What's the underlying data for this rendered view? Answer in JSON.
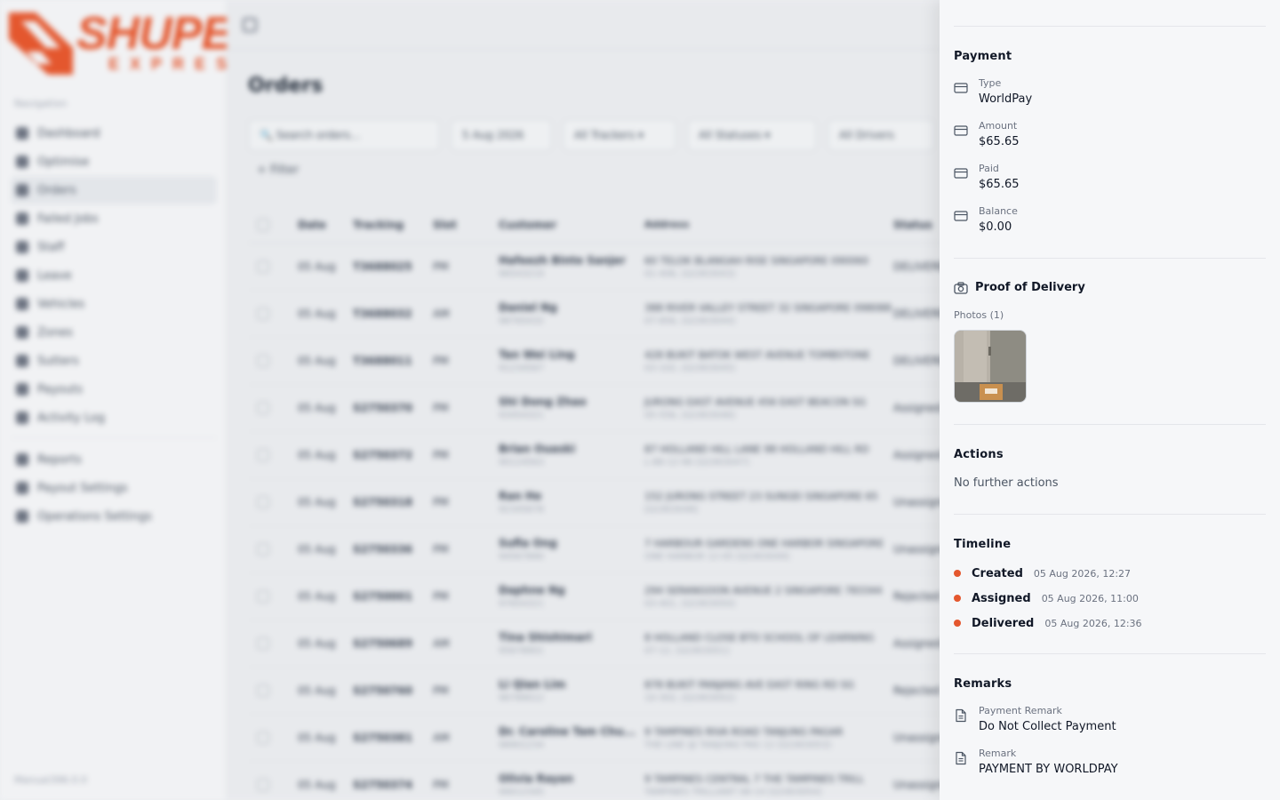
{
  "brand": {
    "name": "SHUPER",
    "sub": "EXPRESS",
    "color": "#e4572e"
  },
  "sidebar": {
    "heading": "Navigation",
    "items": [
      {
        "label": "Dashboard",
        "icon": "grid-icon"
      },
      {
        "label": "Optimise",
        "icon": "route-icon"
      },
      {
        "label": "Orders",
        "icon": "box-icon",
        "active": true
      },
      {
        "label": "Failed Jobs",
        "icon": "alert-icon"
      },
      {
        "label": "Staff",
        "icon": "users-icon"
      },
      {
        "label": "Leave",
        "icon": "calendar-icon"
      },
      {
        "label": "Vehicles",
        "icon": "truck-icon"
      },
      {
        "label": "Zones",
        "icon": "map-icon"
      },
      {
        "label": "Sutters",
        "icon": "people-icon"
      },
      {
        "label": "Payouts",
        "icon": "wallet-icon"
      },
      {
        "label": "Activity Log",
        "icon": "activity-icon"
      }
    ],
    "items2": [
      {
        "label": "Reports",
        "icon": "chart-icon"
      },
      {
        "label": "Payout Settings",
        "icon": "dollar-icon"
      },
      {
        "label": "Operations Settings",
        "icon": "gear-icon"
      }
    ],
    "version": "Manual396.0.0"
  },
  "main": {
    "title": "Orders",
    "filters": {
      "search_placeholder": "Search orders...",
      "date": "5 Aug 2026",
      "tracking": "All Trackers",
      "statuses": "All Statuses",
      "drivers": "All Drivers",
      "filter_label": "+ Filter"
    },
    "columns": [
      "Date",
      "Tracking",
      "Slot",
      "Customer",
      "Address",
      "Status"
    ],
    "rows": [
      {
        "date": "05 Aug",
        "tracking": "T3688025",
        "slot": "PM",
        "name": "Hafeezh Binte Sanjer",
        "phone": "96543219",
        "addr": "60 TELOK BLANGAH RISE SINGAPORE 090060",
        "addr2": "01-406, [Q1903043]",
        "status": "DELIVERED"
      },
      {
        "date": "05 Aug",
        "tracking": "T3688032",
        "slot": "AM",
        "name": "Daniel Ng",
        "phone": "98765432",
        "addr": "388 RIVER VALLEY STREET 32 SINGAPORE 098088",
        "addr2": "07-856, [Q1903044]",
        "status": "DELIVERED"
      },
      {
        "date": "05 Aug",
        "tracking": "T3688011",
        "slot": "PM",
        "name": "Tan Wei Ling",
        "phone": "91234567",
        "addr": "428 BUKIT BATOK WEST AVENUE TOMBSTONE",
        "addr2": "03-102, [Q1903045]",
        "status": "DELIVERED"
      },
      {
        "date": "05 Aug",
        "tracking": "S2750370",
        "slot": "PM",
        "name": "Shi Dong Zhao",
        "phone": "93454321",
        "addr": "JURONG EAST AVENUE 456 EAST BEACON SG",
        "addr2": "05-556, [Q1903046]",
        "status": "Assigned"
      },
      {
        "date": "05 Aug",
        "tracking": "S2750372",
        "slot": "PM",
        "name": "Brian Ouaski",
        "phone": "90124563",
        "addr": "87 HOLLAND HILL LANE 98 HOLLAND HILL RD",
        "addr2": "L-88-12-96 [Q1903047]",
        "status": "Assigned"
      },
      {
        "date": "05 Aug",
        "tracking": "S2750318",
        "slot": "PM",
        "name": "Ran He",
        "phone": "92345678",
        "addr": "152 JURONG STREET 23 SUNGEI SINGAPORE 65",
        "addr2": "[Q1903048]",
        "status": "Unassigned"
      },
      {
        "date": "05 Aug",
        "tracking": "S2750336",
        "slot": "PM",
        "name": "Sufia Ong",
        "phone": "94567890",
        "addr": "7 HARBOUR GARDENS ONE HARBOR SINGAPORE",
        "addr2": "ONE HARBOR 12-05 [Q1903049]",
        "status": "Unassigned"
      },
      {
        "date": "05 Aug",
        "tracking": "S2750001",
        "slot": "PM",
        "name": "Daphne Ng",
        "phone": "97654321",
        "addr": "294 SERANGOON AVENUE 2 SINGAPORE 783344",
        "addr2": "03-401, [Q1903050]",
        "status": "Rejected"
      },
      {
        "date": "05 Aug",
        "tracking": "S2750689",
        "slot": "AM",
        "name": "Tina Shishimari",
        "phone": "95678901",
        "addr": "8 HOLLAND CLOSE BTO SCHOOL OF LEARNING",
        "addr2": "07-12, [Q1903051]",
        "status": "Assigned"
      },
      {
        "date": "05 Aug",
        "tracking": "S2750760",
        "slot": "PM",
        "name": "Li Qian Lim",
        "phone": "96789012",
        "addr": "878 BUKIT PANJANG AVE EAST RING RD SG",
        "addr2": "10-302, [Q1903052]",
        "status": "Rejected"
      },
      {
        "date": "05 Aug",
        "tracking": "S2750381",
        "slot": "AM",
        "name": "Dr. Caroline Tam Chu...",
        "phone": "98901234",
        "addr": "9 TAMPINES RIVA ROAD TANJUNG PAGAR",
        "addr2": "THE LINE @ TANJONG PAG 12 [Q1903053]",
        "status": "Unassigned"
      },
      {
        "date": "05 Aug",
        "tracking": "S2750374",
        "slot": "PM",
        "name": "Olivia Rayan",
        "phone": "99012345",
        "addr": "9 TAMPINES CENTRAL 7 THE TAMPINES TRILL",
        "addr2": "TAMPINES TRILLIANT 08-14 [Q1903054]",
        "status": "Unassigned"
      }
    ]
  },
  "drawer": {
    "payment": {
      "title": "Payment",
      "fields": [
        {
          "label": "Type",
          "value": "WorldPay"
        },
        {
          "label": "Amount",
          "value": "$65.65"
        },
        {
          "label": "Paid",
          "value": "$65.65"
        },
        {
          "label": "Balance",
          "value": "$0.00"
        }
      ]
    },
    "proof": {
      "title": "Proof of Delivery",
      "photos_label": "Photos (1)"
    },
    "actions": {
      "title": "Actions",
      "text": "No further actions"
    },
    "timeline": {
      "title": "Timeline",
      "events": [
        {
          "event": "Created",
          "time": "05 Aug 2026, 12:27"
        },
        {
          "event": "Assigned",
          "time": "05 Aug 2026, 11:00"
        },
        {
          "event": "Delivered",
          "time": "05 Aug 2026, 12:36"
        }
      ],
      "dot_color": "#e4572e"
    },
    "remarks": {
      "title": "Remarks",
      "fields": [
        {
          "label": "Payment Remark",
          "value": "Do Not Collect Payment"
        },
        {
          "label": "Remark",
          "value": "PAYMENT BY WORLDPAY"
        }
      ]
    }
  }
}
